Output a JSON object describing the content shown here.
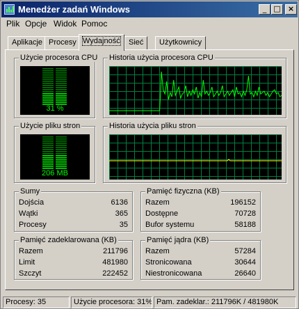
{
  "window": {
    "title": "Menedżer zadań Windows"
  },
  "caption_buttons": {
    "minimize": "_",
    "maximize": "□",
    "close": "×"
  },
  "menu": [
    "Plik",
    "Opcje",
    "Widok",
    "Pomoc"
  ],
  "tabs": [
    "Aplikacje",
    "Procesy",
    "Wydajność",
    "Sieć",
    "Użytkownicy"
  ],
  "active_tab": "Wydajność",
  "cpu_usage": {
    "label": "Użycie procesora CPU",
    "value": "31 %",
    "level": 0.31
  },
  "cpu_history": {
    "label": "Historia użycia procesora CPU"
  },
  "pf_usage": {
    "label": "Użycie pliku stron",
    "value": "206 MB",
    "level": 0.43
  },
  "pf_history": {
    "label": "Historia użycia pliku stron"
  },
  "totals": {
    "label": "Sumy",
    "rows": [
      {
        "label": "Dojścia",
        "value": "6136"
      },
      {
        "label": "Wątki",
        "value": "365"
      },
      {
        "label": "Procesy",
        "value": "35"
      }
    ]
  },
  "physical_memory": {
    "label": "Pamięć fizyczna (KB)",
    "rows": [
      {
        "label": "Razem",
        "value": "196152"
      },
      {
        "label": "Dostępne",
        "value": "70728"
      },
      {
        "label": "Bufor systemu",
        "value": "58188"
      }
    ]
  },
  "commit_charge": {
    "label": "Pamięć zadeklarowana (KB)",
    "rows": [
      {
        "label": "Razem",
        "value": "211796"
      },
      {
        "label": "Limit",
        "value": "481980"
      },
      {
        "label": "Szczyt",
        "value": "222452"
      }
    ]
  },
  "kernel_memory": {
    "label": "Pamięć jądra (KB)",
    "rows": [
      {
        "label": "Razem",
        "value": "57284"
      },
      {
        "label": "Stronicowana",
        "value": "30644"
      },
      {
        "label": "Niestronicowana",
        "value": "26640"
      }
    ]
  },
  "statusbar": {
    "processes": "Procesy: 35",
    "cpu": "Użycie procesora: 31%",
    "commit": "Pam. zadeklar.: 211796K / 481980K"
  },
  "colors": {
    "graph_line": "#00ff00",
    "grid": "#008040",
    "meter_on": "#00ff00",
    "meter_off": "#008000",
    "titlebar": "#0a246a"
  }
}
